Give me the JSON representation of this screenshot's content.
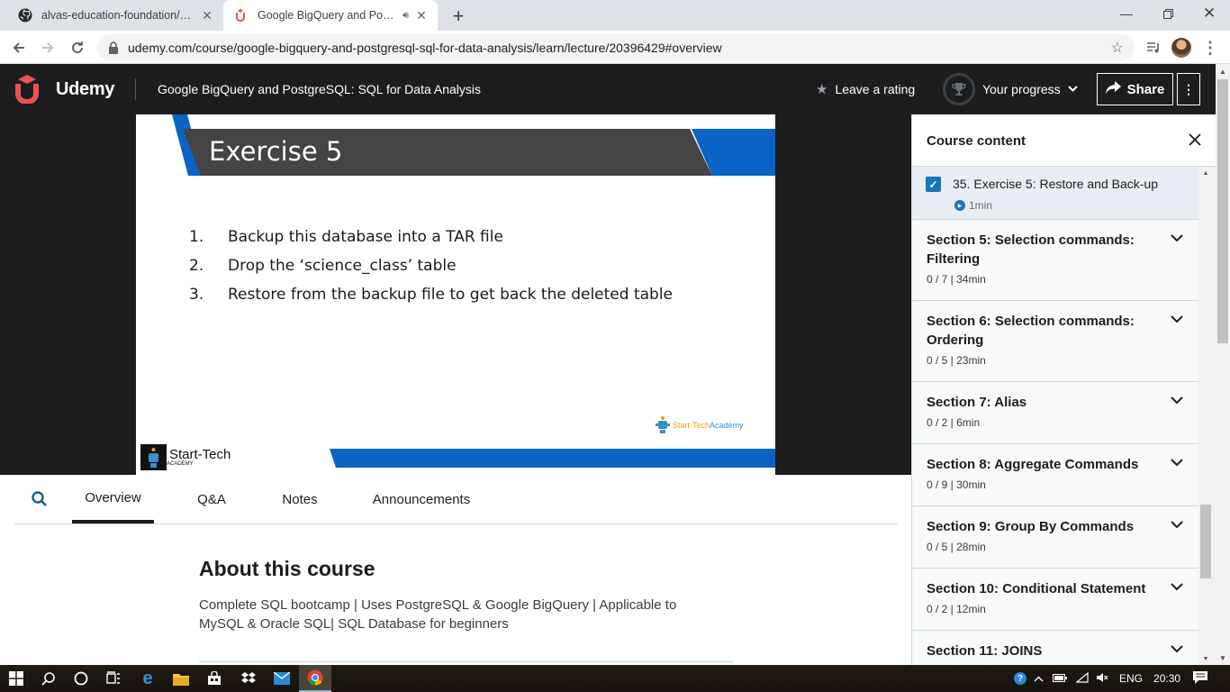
{
  "browser": {
    "tabs": [
      {
        "title": "alvas-education-foundation/Sour",
        "active": false
      },
      {
        "title": "Google BigQuery and Postgr",
        "active": true
      }
    ],
    "url": "udemy.com/course/google-bigquery-and-postgresql-sql-for-data-analysis/learn/lecture/20396429#overview"
  },
  "header": {
    "logo": "Udemy",
    "course_title": "Google BigQuery and PostgreSQL: SQL for Data Analysis",
    "rating_label": "Leave a rating",
    "progress_label": "Your progress",
    "share_label": "Share"
  },
  "slide": {
    "title": "Exercise 5",
    "items": [
      {
        "num": "1.",
        "text": "Backup this database into a TAR file"
      },
      {
        "num": "2.",
        "text": "Drop the ‘science_class’ table"
      },
      {
        "num": "3.",
        "text": "Restore from the backup file to get back the deleted table"
      }
    ],
    "brand": "Start-Tech",
    "brand_sub": "ACADEMY",
    "watermark_a": "Start-Tech",
    "watermark_b": "Academy"
  },
  "content_tabs": [
    "Overview",
    "Q&A",
    "Notes",
    "Announcements"
  ],
  "about": {
    "heading": "About this course",
    "description": "Complete SQL bootcamp | Uses PostgreSQL & Google BigQuery | Applicable to MySQL & Oracle SQL| SQL Database for beginners"
  },
  "sidebar": {
    "title": "Course content",
    "current_lecture": {
      "title": "35. Exercise 5: Restore and Back-up",
      "duration": "1min",
      "completed": true
    },
    "sections": [
      {
        "title": "Section 5: Selection commands: Filtering",
        "meta": "0 / 7 | 34min"
      },
      {
        "title": "Section 6: Selection commands: Ordering",
        "meta": "0 / 5 | 23min"
      },
      {
        "title": "Section 7: Alias",
        "meta": "0 / 2 | 6min"
      },
      {
        "title": "Section 8: Aggregate Commands",
        "meta": "0 / 9 | 30min"
      },
      {
        "title": "Section 9: Group By Commands",
        "meta": "0 / 5 | 28min"
      },
      {
        "title": "Section 10: Conditional Statement",
        "meta": "0 / 2 | 12min"
      },
      {
        "title": "Section 11: JOINS",
        "meta": ""
      }
    ]
  },
  "taskbar": {
    "language": "ENG",
    "time": "20:30"
  },
  "colors": {
    "udemy_red": "#ec5252",
    "header_bg": "#1c1d1f",
    "slide_blue": "#0b63c5",
    "slide_dark": "#444444"
  }
}
